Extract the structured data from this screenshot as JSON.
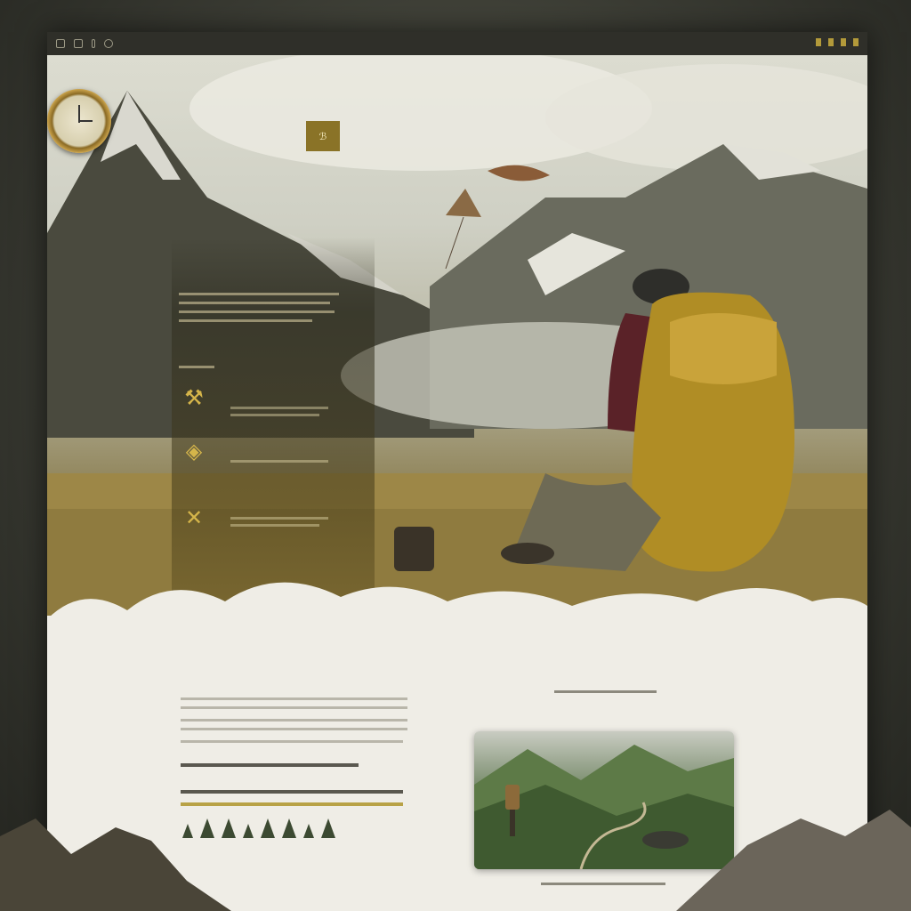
{
  "nav": {
    "links": [
      "",
      "",
      "",
      "",
      "",
      "",
      ""
    ]
  },
  "hero": {
    "badge_text": "ℬ",
    "kicker": "",
    "title": "",
    "section_label_left": "",
    "section_label_right": "",
    "features": [
      {
        "icon": "pickaxe-icon",
        "title": ""
      },
      {
        "icon": "compass-icon",
        "title": ""
      },
      {
        "icon": "crossed-tools-icon",
        "title": ""
      }
    ],
    "feature_labels": [
      "",
      ""
    ]
  },
  "lower": {
    "kicker": "",
    "title": "",
    "photo_caption_top": "",
    "photo_caption_bottom": ""
  },
  "colors": {
    "accent_gold": "#b8a246",
    "nav_bg": "#2f2f29",
    "paper": "#efede6"
  }
}
